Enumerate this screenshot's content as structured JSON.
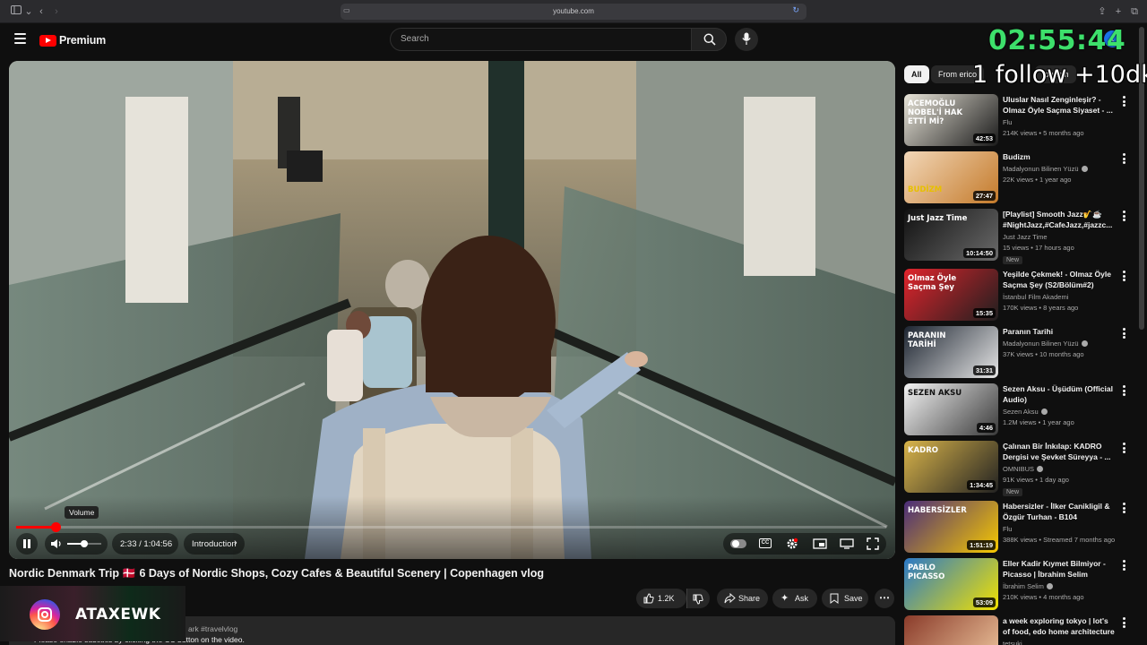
{
  "browser": {
    "url": "youtube.com"
  },
  "header": {
    "logo_text": "Premium",
    "search_placeholder": "Search",
    "avatar_letter": "t"
  },
  "overlay": {
    "timer": "02:55:44",
    "follow_text": "1 follow +10dk",
    "instagram_handle": "ATAXEWK"
  },
  "chips": [
    {
      "label": "All",
      "active": true
    },
    {
      "label": "From erico",
      "active": false
    },
    {
      "label": "tourism",
      "active": false
    }
  ],
  "player": {
    "volume_tooltip": "Volume",
    "time_current": "2:33",
    "time_separator": "/",
    "time_total": "1:04:56",
    "chapter": "Introduction",
    "progress_fraction": 0.045
  },
  "video": {
    "title": "Nordic Denmark Trip 🇩🇰 6 Days of Nordic Shops, Cozy Cafes & Beautiful Scenery | Copenhagen vlog",
    "likes": "1.2K",
    "share_label": "Share",
    "ask_label": "Ask",
    "save_label": "Save",
    "description_tags": "ark #travelvlog",
    "description_text": "Please enable subtitles by clicking the CC button on the video."
  },
  "recommendations": [
    {
      "title": "Uluslar Nasıl Zenginleşir? - Olmaz Öyle Saçma Siyaset - ...",
      "channel": "Flu",
      "verified": false,
      "meta": "214K views • 5 months ago",
      "duration": "42:53",
      "thumb_caption": "ACEMOĞLU NOBEL'İ HAK ETTİ Mİ?",
      "new": ""
    },
    {
      "title": "Budizm",
      "channel": "Madalyonun Bilinen Yüzü",
      "verified": true,
      "meta": "22K views • 1 year ago",
      "duration": "27:47",
      "thumb_caption": "BUDİZM",
      "new": ""
    },
    {
      "title": "[Playlist] Smooth Jazz🎷☕ #NightJazz,#CafeJazz,#jazzc...",
      "channel": "Just Jazz Time",
      "verified": false,
      "meta": "15 views • 17 hours ago",
      "duration": "10:14:50",
      "thumb_caption": "Just Jazz Time",
      "new": "New"
    },
    {
      "title": "Yeşilde Çekmek! - Olmaz Öyle Saçma Şey (S2/Bölüm#2)",
      "channel": "İstanbul Film Akademi",
      "verified": false,
      "meta": "170K views • 8 years ago",
      "duration": "15:35",
      "thumb_caption": "Olmaz Öyle Saçma Şey",
      "new": ""
    },
    {
      "title": "Paranın Tarihi",
      "channel": "Madalyonun Bilinen Yüzü",
      "verified": true,
      "meta": "37K views • 10 months ago",
      "duration": "31:31",
      "thumb_caption": "PARANIN TARİHİ",
      "new": ""
    },
    {
      "title": "Sezen Aksu - Üşüdüm (Official Audio)",
      "channel": "Sezen Aksu",
      "verified": true,
      "meta": "1.2M views • 1 year ago",
      "duration": "4:46",
      "thumb_caption": "SEZEN AKSU",
      "new": ""
    },
    {
      "title": "Çalınan Bir İnkılap: KADRO Dergisi ve Şevket Süreyya - ...",
      "channel": "OMNIBUS",
      "verified": true,
      "meta": "91K views • 1 day ago",
      "duration": "1:34:45",
      "thumb_caption": "KADRO",
      "new": "New"
    },
    {
      "title": "Habersizler - İlker Canikligil & Özgür Turhan - B104",
      "channel": "Flu",
      "verified": false,
      "meta": "388K views • Streamed 7 months ago",
      "duration": "1:51:19",
      "thumb_caption": "HABERSİZLER",
      "new": ""
    },
    {
      "title": "Eller Kadir Kıymet Bilmiyor - Picasso | İbrahim Selim",
      "channel": "İbrahim Selim",
      "verified": true,
      "meta": "210K views • 4 months ago",
      "duration": "53:09",
      "thumb_caption": "PABLO PICASSO",
      "new": ""
    },
    {
      "title": "a week exploring tokyo | lot's of food, edo home architecture & ...",
      "channel": "tetsuki",
      "verified": false,
      "meta": "",
      "duration": "",
      "thumb_caption": "",
      "new": ""
    }
  ],
  "colors": {
    "background": "#0f0f0f",
    "accent_red": "#ff0000",
    "timer_green": "#3de06b",
    "chip_active": "#f1f1f1"
  }
}
